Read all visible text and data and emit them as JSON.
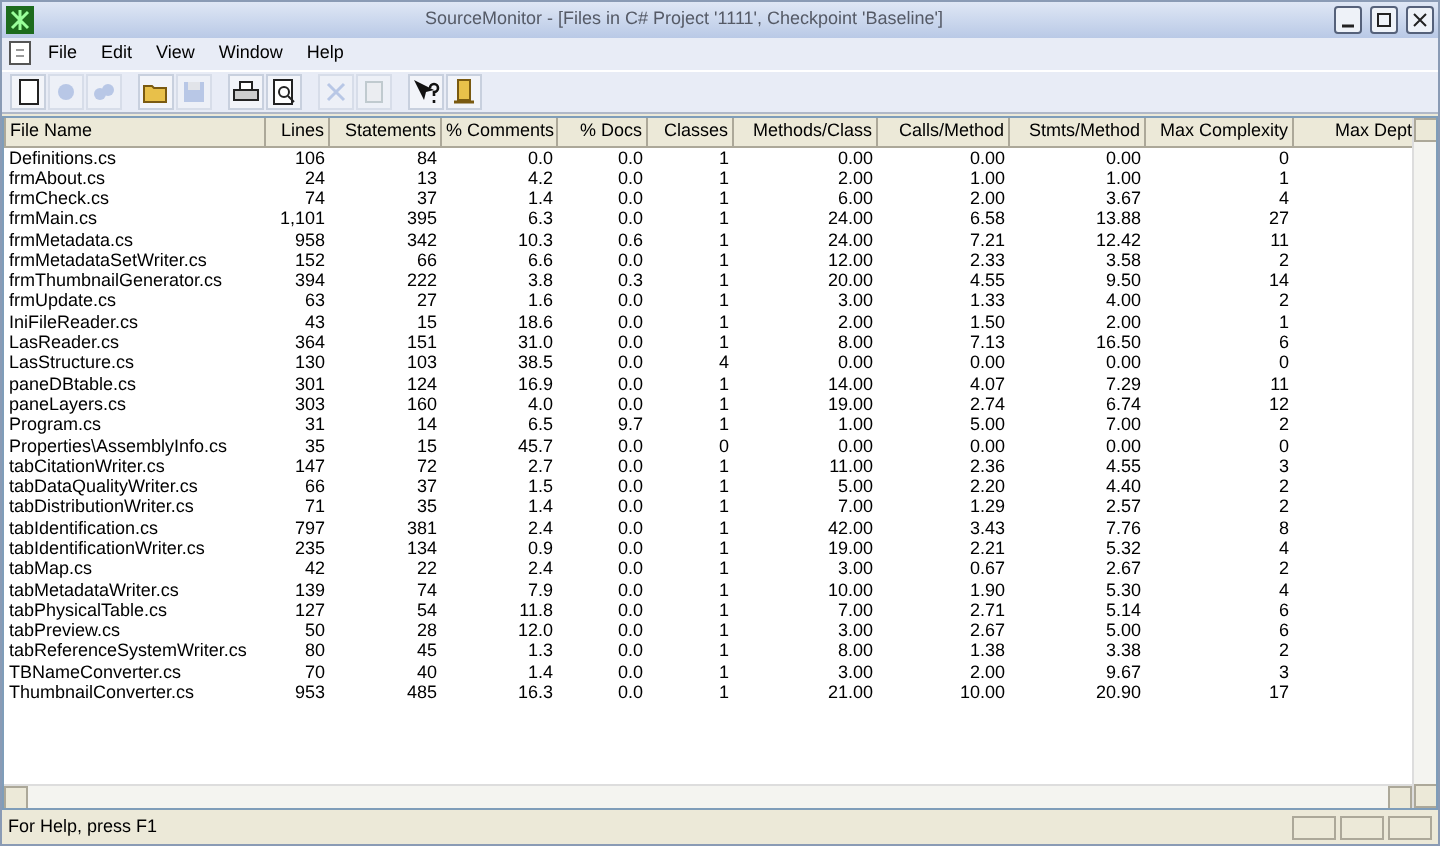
{
  "window": {
    "title": "SourceMonitor - [Files in C# Project '1111', Checkpoint 'Baseline']"
  },
  "menu": [
    {
      "label": "File"
    },
    {
      "label": "Edit"
    },
    {
      "label": "View"
    },
    {
      "label": "Window"
    },
    {
      "label": "Help"
    }
  ],
  "toolbar": [
    {
      "kind": "new",
      "disabled": false
    },
    {
      "kind": "dot",
      "disabled": true
    },
    {
      "kind": "cloud",
      "disabled": true
    },
    {
      "kind": "open",
      "disabled": false
    },
    {
      "kind": "save",
      "disabled": true
    },
    {
      "kind": "print",
      "disabled": false
    },
    {
      "kind": "preview",
      "disabled": false
    },
    {
      "kind": "delete",
      "disabled": true
    },
    {
      "kind": "chart",
      "disabled": true
    },
    {
      "kind": "help",
      "disabled": false
    },
    {
      "kind": "exit",
      "disabled": false
    }
  ],
  "table": {
    "columns": [
      "File Name",
      "Lines",
      "Statements",
      "% Comments",
      "% Docs",
      "Classes",
      "Methods/Class",
      "Calls/Method",
      "Stmts/Method",
      "Max Complexity",
      "Max Dept"
    ],
    "rows": [
      [
        "Definitions.cs",
        "106",
        "84",
        "0.0",
        "0.0",
        "1",
        "0.00",
        "0.00",
        "0.00",
        "0"
      ],
      [
        "frmAbout.cs",
        "24",
        "13",
        "4.2",
        "0.0",
        "1",
        "2.00",
        "1.00",
        "1.00",
        "1"
      ],
      [
        "frmCheck.cs",
        "74",
        "37",
        "1.4",
        "0.0",
        "1",
        "6.00",
        "2.00",
        "3.67",
        "4"
      ],
      [
        "frmMain.cs",
        "1,101",
        "395",
        "6.3",
        "0.0",
        "1",
        "24.00",
        "6.58",
        "13.88",
        "27"
      ],
      [
        "frmMetadata.cs",
        "958",
        "342",
        "10.3",
        "0.6",
        "1",
        "24.00",
        "7.21",
        "12.42",
        "11"
      ],
      [
        "frmMetadataSetWriter.cs",
        "152",
        "66",
        "6.6",
        "0.0",
        "1",
        "12.00",
        "2.33",
        "3.58",
        "2"
      ],
      [
        "frmThumbnailGenerator.cs",
        "394",
        "222",
        "3.8",
        "0.3",
        "1",
        "20.00",
        "4.55",
        "9.50",
        "14"
      ],
      [
        "frmUpdate.cs",
        "63",
        "27",
        "1.6",
        "0.0",
        "1",
        "3.00",
        "1.33",
        "4.00",
        "2"
      ],
      [
        "IniFileReader.cs",
        "43",
        "15",
        "18.6",
        "0.0",
        "1",
        "2.00",
        "1.50",
        "2.00",
        "1"
      ],
      [
        "LasReader.cs",
        "364",
        "151",
        "31.0",
        "0.0",
        "1",
        "8.00",
        "7.13",
        "16.50",
        "6"
      ],
      [
        "LasStructure.cs",
        "130",
        "103",
        "38.5",
        "0.0",
        "4",
        "0.00",
        "0.00",
        "0.00",
        "0"
      ],
      [
        "paneDBtable.cs",
        "301",
        "124",
        "16.9",
        "0.0",
        "1",
        "14.00",
        "4.07",
        "7.29",
        "11"
      ],
      [
        "paneLayers.cs",
        "303",
        "160",
        "4.0",
        "0.0",
        "1",
        "19.00",
        "2.74",
        "6.74",
        "12"
      ],
      [
        "Program.cs",
        "31",
        "14",
        "6.5",
        "9.7",
        "1",
        "1.00",
        "5.00",
        "7.00",
        "2"
      ],
      [
        "Properties\\AssemblyInfo.cs",
        "35",
        "15",
        "45.7",
        "0.0",
        "0",
        "0.00",
        "0.00",
        "0.00",
        "0"
      ],
      [
        "tabCitationWriter.cs",
        "147",
        "72",
        "2.7",
        "0.0",
        "1",
        "11.00",
        "2.36",
        "4.55",
        "3"
      ],
      [
        "tabDataQualityWriter.cs",
        "66",
        "37",
        "1.5",
        "0.0",
        "1",
        "5.00",
        "2.20",
        "4.40",
        "2"
      ],
      [
        "tabDistributionWriter.cs",
        "71",
        "35",
        "1.4",
        "0.0",
        "1",
        "7.00",
        "1.29",
        "2.57",
        "2"
      ],
      [
        "tabIdentification.cs",
        "797",
        "381",
        "2.4",
        "0.0",
        "1",
        "42.00",
        "3.43",
        "7.76",
        "8"
      ],
      [
        "tabIdentificationWriter.cs",
        "235",
        "134",
        "0.9",
        "0.0",
        "1",
        "19.00",
        "2.21",
        "5.32",
        "4"
      ],
      [
        "tabMap.cs",
        "42",
        "22",
        "2.4",
        "0.0",
        "1",
        "3.00",
        "0.67",
        "2.67",
        "2"
      ],
      [
        "tabMetadataWriter.cs",
        "139",
        "74",
        "7.9",
        "0.0",
        "1",
        "10.00",
        "1.90",
        "5.30",
        "4"
      ],
      [
        "tabPhysicalTable.cs",
        "127",
        "54",
        "11.8",
        "0.0",
        "1",
        "7.00",
        "2.71",
        "5.14",
        "6"
      ],
      [
        "tabPreview.cs",
        "50",
        "28",
        "12.0",
        "0.0",
        "1",
        "3.00",
        "2.67",
        "5.00",
        "6"
      ],
      [
        "tabReferenceSystemWriter.cs",
        "80",
        "45",
        "1.3",
        "0.0",
        "1",
        "8.00",
        "1.38",
        "3.38",
        "2"
      ],
      [
        "TBNameConverter.cs",
        "70",
        "40",
        "1.4",
        "0.0",
        "1",
        "3.00",
        "2.00",
        "9.67",
        "3"
      ],
      [
        "ThumbnailConverter.cs",
        "953",
        "485",
        "16.3",
        "0.0",
        "1",
        "21.00",
        "10.00",
        "20.90",
        "17"
      ]
    ]
  },
  "status_bar": {
    "text": "For Help, press F1"
  }
}
